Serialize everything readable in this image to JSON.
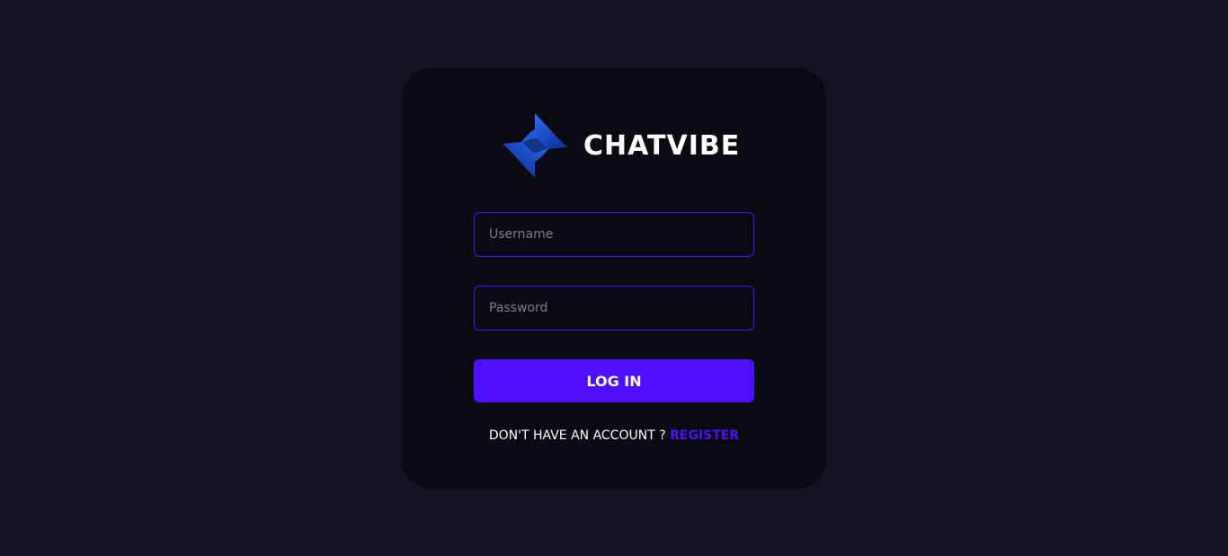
{
  "brand": {
    "name": "CHATVIBE",
    "logo_icon": "chatvibe-logo-icon"
  },
  "form": {
    "username_placeholder": "Username",
    "username_value": "",
    "password_placeholder": "Password",
    "password_value": "",
    "login_label": "LOG IN"
  },
  "footer": {
    "prompt": "DON'T HAVE AN ACCOUNT ?",
    "register_label": "REGISTER"
  },
  "colors": {
    "page_background": "#131324",
    "card_background": "#0a0a12",
    "accent": "#4e0eff",
    "text": "#ffffff"
  }
}
